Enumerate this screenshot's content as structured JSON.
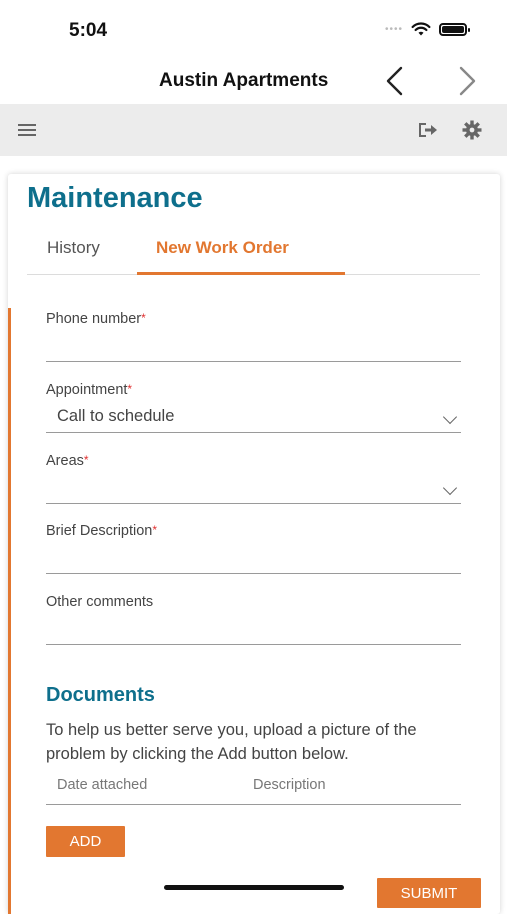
{
  "status_bar": {
    "time": "5:04"
  },
  "browser": {
    "title": "Austin Apartments",
    "back_icon": "chevron-left-icon",
    "forward_icon": "chevron-right-icon"
  },
  "toolbar": {
    "menu_icon": "hamburger-menu-icon",
    "logout_icon": "logout-icon",
    "settings_icon": "gear-icon"
  },
  "page": {
    "title": "Maintenance",
    "tabs": [
      {
        "label": "History",
        "active": false
      },
      {
        "label": "New Work Order",
        "active": true
      }
    ]
  },
  "form": {
    "phone": {
      "label": "Phone number",
      "required_mark": "*",
      "value": ""
    },
    "appointment": {
      "label": "Appointment",
      "required_mark": "*",
      "value": "Call to schedule"
    },
    "areas": {
      "label": "Areas",
      "required_mark": "*",
      "value": ""
    },
    "brief_description": {
      "label": "Brief Description",
      "required_mark": "*",
      "value": ""
    },
    "other_comments": {
      "label": "Other comments",
      "value": ""
    }
  },
  "documents": {
    "title": "Documents",
    "instructions": "To help us better serve you, upload a picture of the problem by clicking the Add button below.",
    "columns": [
      "Date attached",
      "Description"
    ],
    "add_label": "ADD"
  },
  "submit_label": "SUBMIT",
  "colors": {
    "accent": "#e27730",
    "heading": "#0e6f8c",
    "toolbar_bg": "#ececec"
  }
}
